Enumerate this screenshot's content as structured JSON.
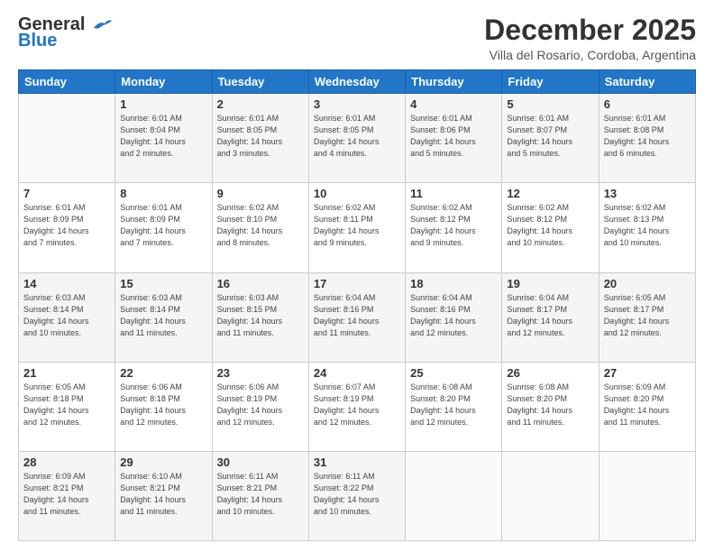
{
  "header": {
    "logo_line1": "General",
    "logo_line2": "Blue",
    "month": "December 2025",
    "location": "Villa del Rosario, Cordoba, Argentina"
  },
  "days_of_week": [
    "Sunday",
    "Monday",
    "Tuesday",
    "Wednesday",
    "Thursday",
    "Friday",
    "Saturday"
  ],
  "weeks": [
    [
      {
        "day": "",
        "info": ""
      },
      {
        "day": "1",
        "info": "Sunrise: 6:01 AM\nSunset: 8:04 PM\nDaylight: 14 hours\nand 2 minutes."
      },
      {
        "day": "2",
        "info": "Sunrise: 6:01 AM\nSunset: 8:05 PM\nDaylight: 14 hours\nand 3 minutes."
      },
      {
        "day": "3",
        "info": "Sunrise: 6:01 AM\nSunset: 8:05 PM\nDaylight: 14 hours\nand 4 minutes."
      },
      {
        "day": "4",
        "info": "Sunrise: 6:01 AM\nSunset: 8:06 PM\nDaylight: 14 hours\nand 5 minutes."
      },
      {
        "day": "5",
        "info": "Sunrise: 6:01 AM\nSunset: 8:07 PM\nDaylight: 14 hours\nand 5 minutes."
      },
      {
        "day": "6",
        "info": "Sunrise: 6:01 AM\nSunset: 8:08 PM\nDaylight: 14 hours\nand 6 minutes."
      }
    ],
    [
      {
        "day": "7",
        "info": "Sunrise: 6:01 AM\nSunset: 8:09 PM\nDaylight: 14 hours\nand 7 minutes."
      },
      {
        "day": "8",
        "info": "Sunrise: 6:01 AM\nSunset: 8:09 PM\nDaylight: 14 hours\nand 7 minutes."
      },
      {
        "day": "9",
        "info": "Sunrise: 6:02 AM\nSunset: 8:10 PM\nDaylight: 14 hours\nand 8 minutes."
      },
      {
        "day": "10",
        "info": "Sunrise: 6:02 AM\nSunset: 8:11 PM\nDaylight: 14 hours\nand 9 minutes."
      },
      {
        "day": "11",
        "info": "Sunrise: 6:02 AM\nSunset: 8:12 PM\nDaylight: 14 hours\nand 9 minutes."
      },
      {
        "day": "12",
        "info": "Sunrise: 6:02 AM\nSunset: 8:12 PM\nDaylight: 14 hours\nand 10 minutes."
      },
      {
        "day": "13",
        "info": "Sunrise: 6:02 AM\nSunset: 8:13 PM\nDaylight: 14 hours\nand 10 minutes."
      }
    ],
    [
      {
        "day": "14",
        "info": "Sunrise: 6:03 AM\nSunset: 8:14 PM\nDaylight: 14 hours\nand 10 minutes."
      },
      {
        "day": "15",
        "info": "Sunrise: 6:03 AM\nSunset: 8:14 PM\nDaylight: 14 hours\nand 11 minutes."
      },
      {
        "day": "16",
        "info": "Sunrise: 6:03 AM\nSunset: 8:15 PM\nDaylight: 14 hours\nand 11 minutes."
      },
      {
        "day": "17",
        "info": "Sunrise: 6:04 AM\nSunset: 8:16 PM\nDaylight: 14 hours\nand 11 minutes."
      },
      {
        "day": "18",
        "info": "Sunrise: 6:04 AM\nSunset: 8:16 PM\nDaylight: 14 hours\nand 12 minutes."
      },
      {
        "day": "19",
        "info": "Sunrise: 6:04 AM\nSunset: 8:17 PM\nDaylight: 14 hours\nand 12 minutes."
      },
      {
        "day": "20",
        "info": "Sunrise: 6:05 AM\nSunset: 8:17 PM\nDaylight: 14 hours\nand 12 minutes."
      }
    ],
    [
      {
        "day": "21",
        "info": "Sunrise: 6:05 AM\nSunset: 8:18 PM\nDaylight: 14 hours\nand 12 minutes."
      },
      {
        "day": "22",
        "info": "Sunrise: 6:06 AM\nSunset: 8:18 PM\nDaylight: 14 hours\nand 12 minutes."
      },
      {
        "day": "23",
        "info": "Sunrise: 6:06 AM\nSunset: 8:19 PM\nDaylight: 14 hours\nand 12 minutes."
      },
      {
        "day": "24",
        "info": "Sunrise: 6:07 AM\nSunset: 8:19 PM\nDaylight: 14 hours\nand 12 minutes."
      },
      {
        "day": "25",
        "info": "Sunrise: 6:08 AM\nSunset: 8:20 PM\nDaylight: 14 hours\nand 12 minutes."
      },
      {
        "day": "26",
        "info": "Sunrise: 6:08 AM\nSunset: 8:20 PM\nDaylight: 14 hours\nand 11 minutes."
      },
      {
        "day": "27",
        "info": "Sunrise: 6:09 AM\nSunset: 8:20 PM\nDaylight: 14 hours\nand 11 minutes."
      }
    ],
    [
      {
        "day": "28",
        "info": "Sunrise: 6:09 AM\nSunset: 8:21 PM\nDaylight: 14 hours\nand 11 minutes."
      },
      {
        "day": "29",
        "info": "Sunrise: 6:10 AM\nSunset: 8:21 PM\nDaylight: 14 hours\nand 11 minutes."
      },
      {
        "day": "30",
        "info": "Sunrise: 6:11 AM\nSunset: 8:21 PM\nDaylight: 14 hours\nand 10 minutes."
      },
      {
        "day": "31",
        "info": "Sunrise: 6:11 AM\nSunset: 8:22 PM\nDaylight: 14 hours\nand 10 minutes."
      },
      {
        "day": "",
        "info": ""
      },
      {
        "day": "",
        "info": ""
      },
      {
        "day": "",
        "info": ""
      }
    ]
  ]
}
